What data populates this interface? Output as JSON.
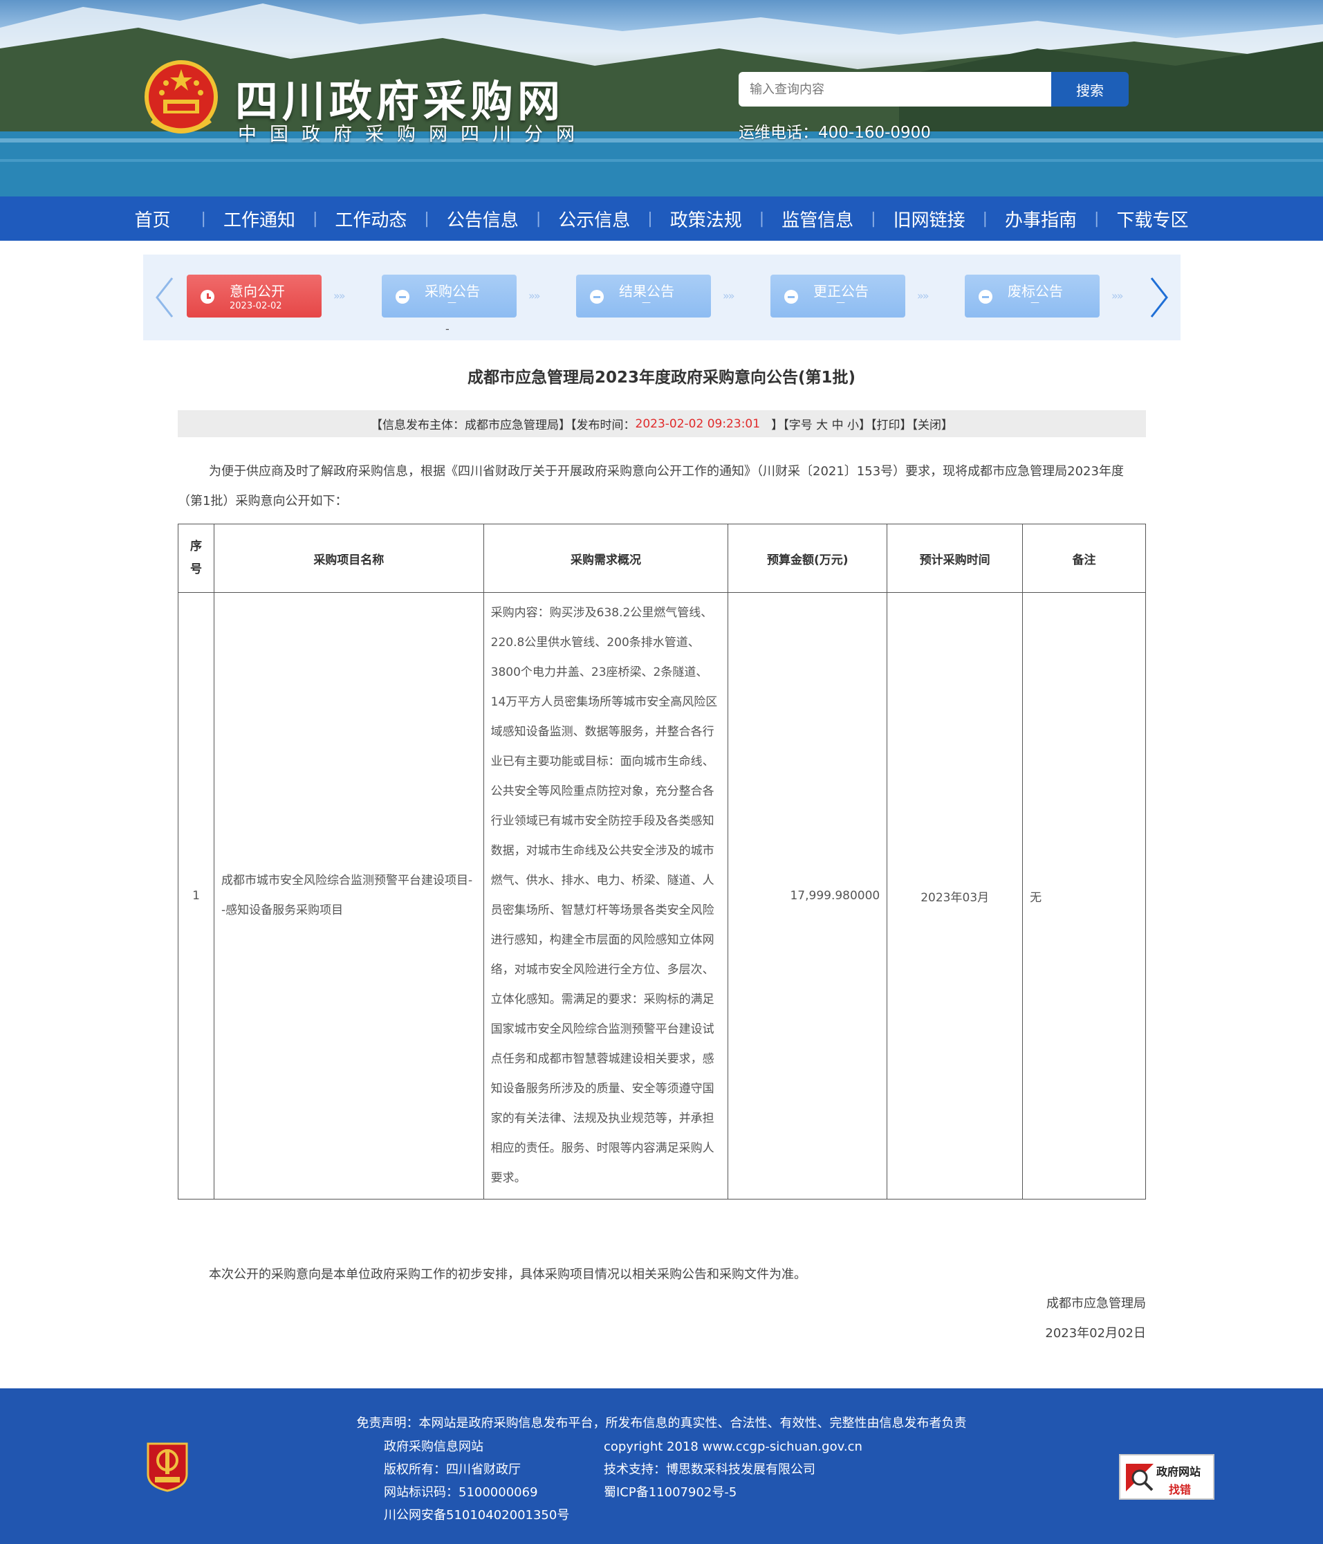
{
  "header": {
    "site_title": "四川政府采购网",
    "site_subtitle": "中国政府采购网四川分网",
    "search_placeholder": "输入查询内容",
    "search_button": "搜索",
    "hotline": "运维电话：400-160-0900"
  },
  "nav": {
    "items": [
      "首页",
      "工作通知",
      "工作动态",
      "公告信息",
      "公示信息",
      "政策法规",
      "监管信息",
      "旧网链接",
      "办事指南",
      "下载专区"
    ]
  },
  "process": {
    "steps": [
      {
        "label": "意向公开",
        "sub": "2023-02-02",
        "active": true
      },
      {
        "label": "采购公告",
        "sub": "—",
        "active": false
      },
      {
        "label": "结果公告",
        "sub": "—",
        "active": false
      },
      {
        "label": "更正公告",
        "sub": "—",
        "active": false
      },
      {
        "label": "废标公告",
        "sub": "—",
        "active": false
      }
    ],
    "chevrons": "»»",
    "dash": "-"
  },
  "article": {
    "title": "成都市应急管理局2023年度政府采购意向公告(第1批)",
    "meta_publisher": "【信息发布主体：成都市应急管理局】【发布时间：",
    "meta_time": "2023-02-02 09:23:01",
    "meta_tail": "   】【字号 大 中 小】【打印】【关闭】",
    "intro": "为便于供应商及时了解政府采购信息，根据《四川省财政厅关于开展政府采购意向公开工作的通知》（川财采〔2021〕153号）要求，现将成都市应急管理局2023年度（第1批）采购意向公开如下：",
    "table": {
      "headers": [
        "序号",
        "采购项目名称",
        "采购需求概况",
        "预算金额(万元)",
        "预计采购时间",
        "备注"
      ],
      "rows": [
        {
          "seq": "1",
          "name": "成都市城市安全风险综合监测预警平台建设项目--感知设备服务采购项目",
          "desc": "采购内容：购买涉及638.2公里燃气管线、220.8公里供水管线、200条排水管道、3800个电力井盖、23座桥梁、2条隧道、14万平方人员密集场所等城市安全高风险区域感知设备监测、数据等服务，并整合各行业已有主要功能或目标：面向城市生命线、公共安全等风险重点防控对象，充分整合各行业领域已有城市安全防控手段及各类感知数据，对城市生命线及公共安全涉及的城市燃气、供水、排水、电力、桥梁、隧道、人员密集场所、智慧灯杆等场景各类安全风险进行感知，构建全市层面的风险感知立体网络，对城市安全风险进行全方位、多层次、立体化感知。需满足的要求：采购标的满足国家城市安全风险综合监测预警平台建设试点任务和成都市智慧蓉城建设相关要求，感知设备服务所涉及的质量、安全等须遵守国家的有关法律、法规及执业规范等，并承担相应的责任。服务、时限等内容满足采购人要求。",
          "budget": "17,999.980000",
          "time": "2023年03月",
          "note": "无"
        }
      ]
    },
    "closing": "本次公开的采购意向是本单位政府采购工作的初步安排，具体采购项目情况以相关采购公告和采购文件为准。",
    "sign_org": "成都市应急管理局",
    "sign_date": "2023年02月02日"
  },
  "footer": {
    "disclaimer": "免责声明：本网站是政府采购信息发布平台，所发布信息的真实性、合法性、有效性、完整性由信息发布者负责",
    "left_lines": [
      "政府采购信息网站",
      "版权所有：四川省财政厅",
      "网站标识码：5100000069",
      "川公网安备51010402001350号"
    ],
    "right_lines": [
      "copyright 2018 www.ccgp-sichuan.gov.cn",
      "技术支持：博思数采科技发展有限公司",
      "蜀ICP备11007902号-5"
    ],
    "find_error_line1": "政府网站",
    "find_error_line2": "找错"
  },
  "colors": {
    "nav_bg": "#1f5bbd",
    "footer_bg": "#2156b0",
    "active_step": "#e64747",
    "inactive_step": "#8dbcf2",
    "highlight_red": "#e02b2b"
  },
  "icons": [
    "national-emblem-icon",
    "arrow-left-icon",
    "arrow-right-icon",
    "clock-icon",
    "minus-circle-icon",
    "party-emblem-icon",
    "magnifier-icon"
  ]
}
